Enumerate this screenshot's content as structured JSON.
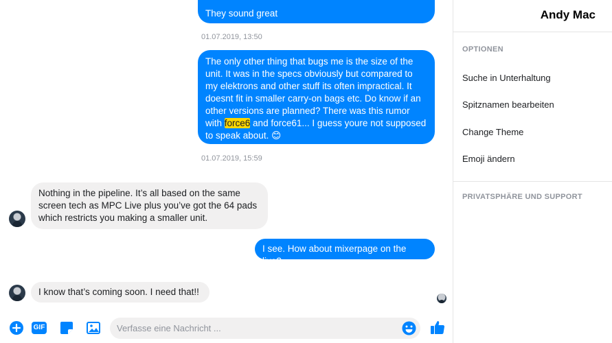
{
  "conversation": {
    "messages": [
      {
        "id": "m1",
        "text": "They sound great"
      },
      {
        "id": "ts1",
        "text": "01.07.2019, 13:50"
      },
      {
        "id": "m2",
        "text_before": "The only other thing that bugs me is the size of the unit. It was in the specs obviously but compared to my elektrons and other stuff its often impractical. It doesnt fit in smaller carry-on bags etc. Do know if an other versions are planned? There was this rumor with ",
        "highlight": "force6",
        "text_after": " and force61... I guess youre not supposed to speak about. 😊"
      },
      {
        "id": "ts2",
        "text": "01.07.2019, 15:59"
      },
      {
        "id": "m3",
        "text": "Nothing in the pipeline.  It’s all based on the same screen tech as MPC Live plus you’ve got the 64 pads which restricts you making a smaller unit."
      },
      {
        "id": "m4",
        "text": "I see. How about mixerpage on the live?"
      },
      {
        "id": "m5",
        "text": "I know that’s coming soon.  I need that!!"
      }
    ]
  },
  "composer": {
    "placeholder": "Verfasse eine Nachricht ...",
    "gif_label": "GIF"
  },
  "sidebar": {
    "title": "Andy Mac",
    "section_options": "OPTIONEN",
    "items": [
      {
        "label": "Suche in Unterhaltung"
      },
      {
        "label": "Spitznamen bearbeiten"
      },
      {
        "label": "Change Theme"
      },
      {
        "label": "Emoji ändern"
      }
    ],
    "section_privacy": "PRIVATSPHÄRE UND SUPPORT"
  },
  "colors": {
    "accent": "#0084ff",
    "incoming_bubble": "#f1f0f0",
    "highlight": "#ffd700"
  },
  "icons": [
    "plus-icon",
    "gif-icon",
    "sticker-icon",
    "image-icon",
    "emoji-icon",
    "thumbs-up-icon"
  ]
}
